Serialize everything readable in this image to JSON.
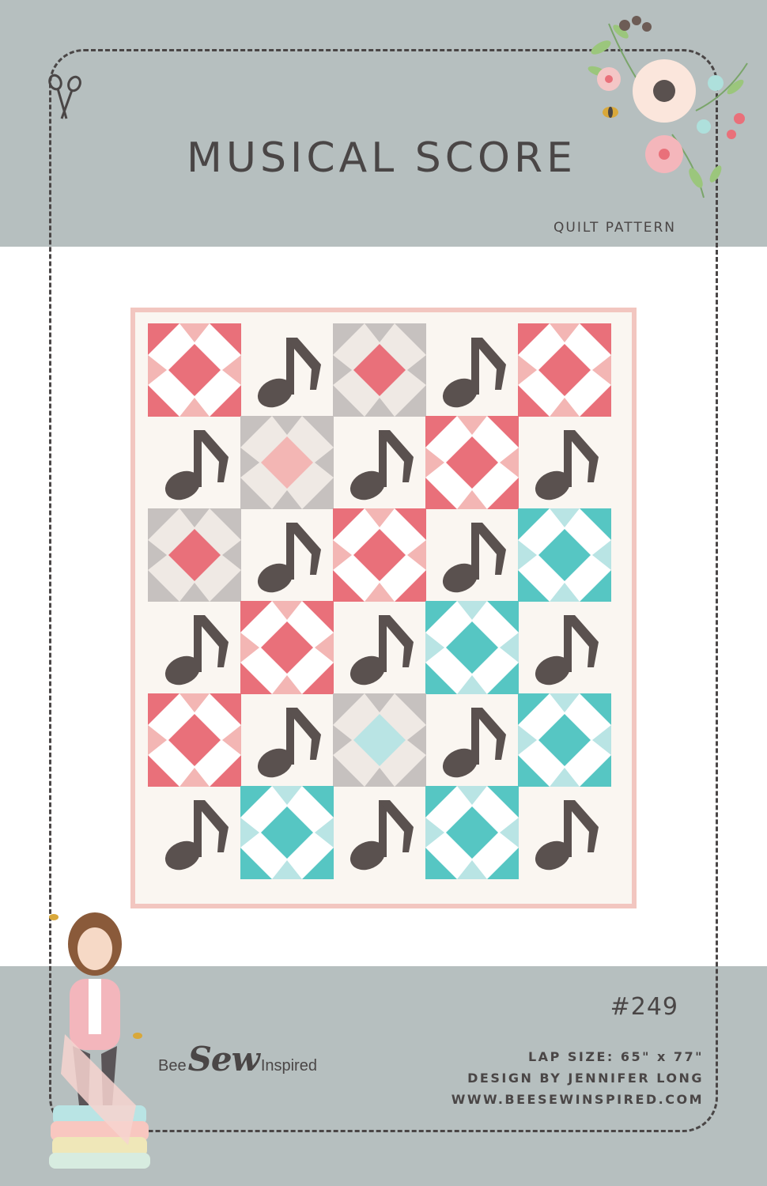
{
  "cover": {
    "title": "MUSICAL SCORE",
    "subtitle": "QUILT PATTERN",
    "pattern_number": "#249",
    "info": {
      "size": "LAP SIZE: 65\" x 77\"",
      "designer": "DESIGN BY JENNIFER LONG",
      "website": "WWW.BEESEWINSPIRED.COM"
    },
    "brand": {
      "part1": "Bee",
      "part2": "Sew",
      "part3": "Inspired"
    }
  },
  "colors": {
    "band": "#b6bfbf",
    "text": "#4a4646",
    "pink_border": "#f2c6c0",
    "quilt_background": "#faf6f1",
    "coral": "#e9707a",
    "pink": "#f3b6b4",
    "aqua": "#56c6c3",
    "light_aqua": "#b9e4e4",
    "grey": "#c6c1bf",
    "note": "#5a514f"
  },
  "quilt": {
    "rows": [
      [
        "coral-square",
        "note",
        "grey-square",
        "note",
        "coral-square"
      ],
      [
        "note",
        "pink-square",
        "note",
        "coral-square",
        "note"
      ],
      [
        "grey-square",
        "note",
        "coral-square",
        "note",
        "aqua-square"
      ],
      [
        "note",
        "coral-square",
        "note",
        "aqua-square",
        "note"
      ],
      [
        "coral-square",
        "note",
        "light-aqua-square",
        "note",
        "aqua-square"
      ],
      [
        "note",
        "aqua-square",
        "note",
        "aqua-square",
        "note"
      ]
    ]
  }
}
